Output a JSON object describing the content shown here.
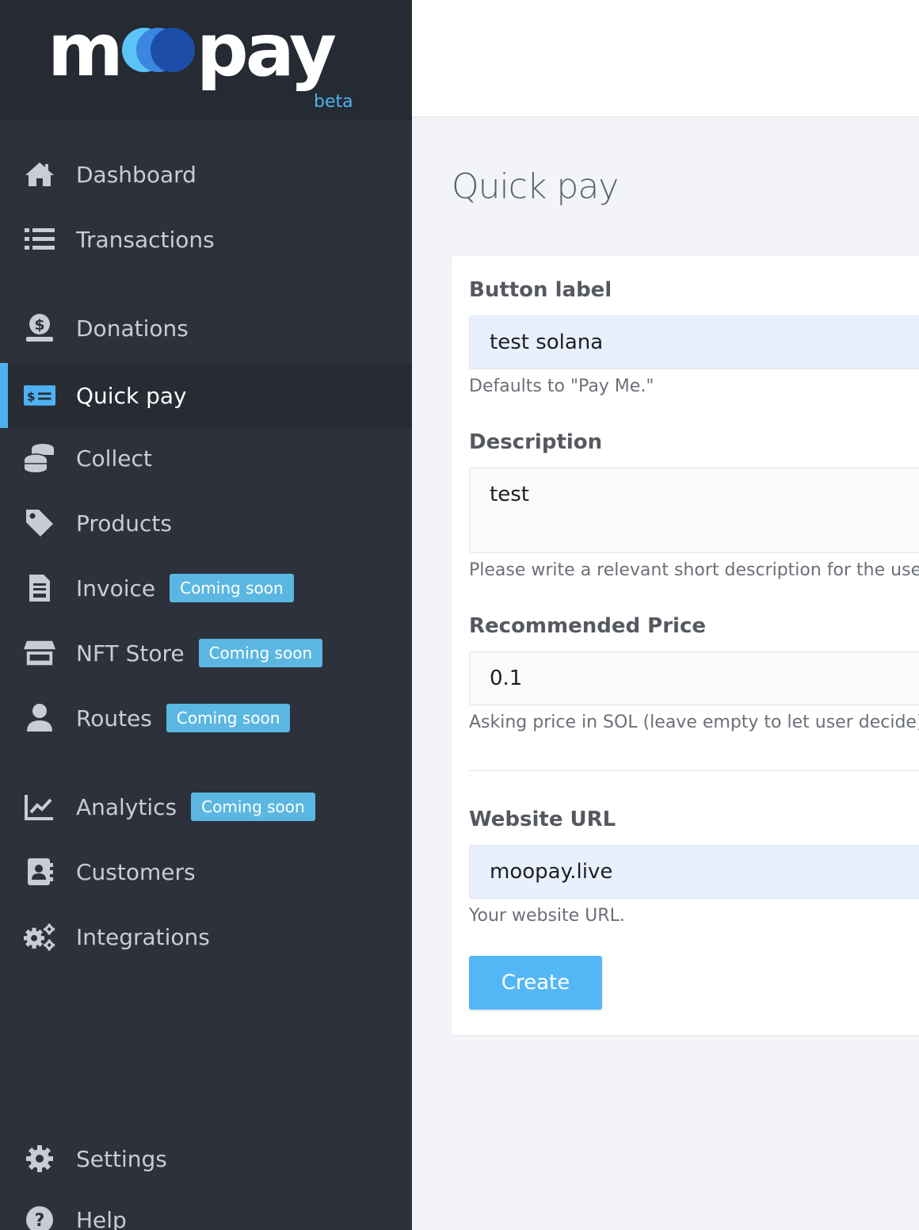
{
  "brand": {
    "name_left": "m",
    "name_right": "pay",
    "badge": "beta"
  },
  "sidebar": {
    "items": [
      {
        "label": "Dashboard",
        "icon": "home-icon"
      },
      {
        "label": "Transactions",
        "icon": "list-icon"
      },
      {
        "label": "Donations",
        "icon": "donation-icon"
      },
      {
        "label": "Quick pay",
        "icon": "money-card-icon",
        "active": true
      },
      {
        "label": "Collect",
        "icon": "coins-icon"
      },
      {
        "label": "Products",
        "icon": "tag-icon"
      },
      {
        "label": "Invoice",
        "icon": "invoice-icon",
        "badge": "Coming soon"
      },
      {
        "label": "NFT Store",
        "icon": "store-icon",
        "badge": "Coming soon"
      },
      {
        "label": "Routes",
        "icon": "user-icon",
        "badge": "Coming soon"
      },
      {
        "label": "Analytics",
        "icon": "chart-icon",
        "badge": "Coming soon"
      },
      {
        "label": "Customers",
        "icon": "contact-book-icon"
      },
      {
        "label": "Integrations",
        "icon": "gears-icon"
      },
      {
        "label": "Settings",
        "icon": "gear-icon"
      },
      {
        "label": "Help",
        "icon": "question-icon"
      }
    ]
  },
  "main": {
    "title": "Quick pay",
    "form": {
      "button_label": {
        "label": "Button label",
        "value": "test solana",
        "help": "Defaults to \"Pay Me.\""
      },
      "description": {
        "label": "Description",
        "value": "test",
        "help": "Please write a relevant short description for the user."
      },
      "price": {
        "label": "Recommended Price",
        "value": "0.1",
        "help": "Asking price in SOL (leave empty to let user decide)"
      },
      "website": {
        "label": "Website URL",
        "value": "moopay.live",
        "help": "Your website URL."
      },
      "submit": "Create"
    }
  },
  "colors": {
    "sidebar": "#2c313c",
    "accent": "#4fb1f3",
    "badge": "#5bb7e2",
    "button": "#54b7f5"
  }
}
